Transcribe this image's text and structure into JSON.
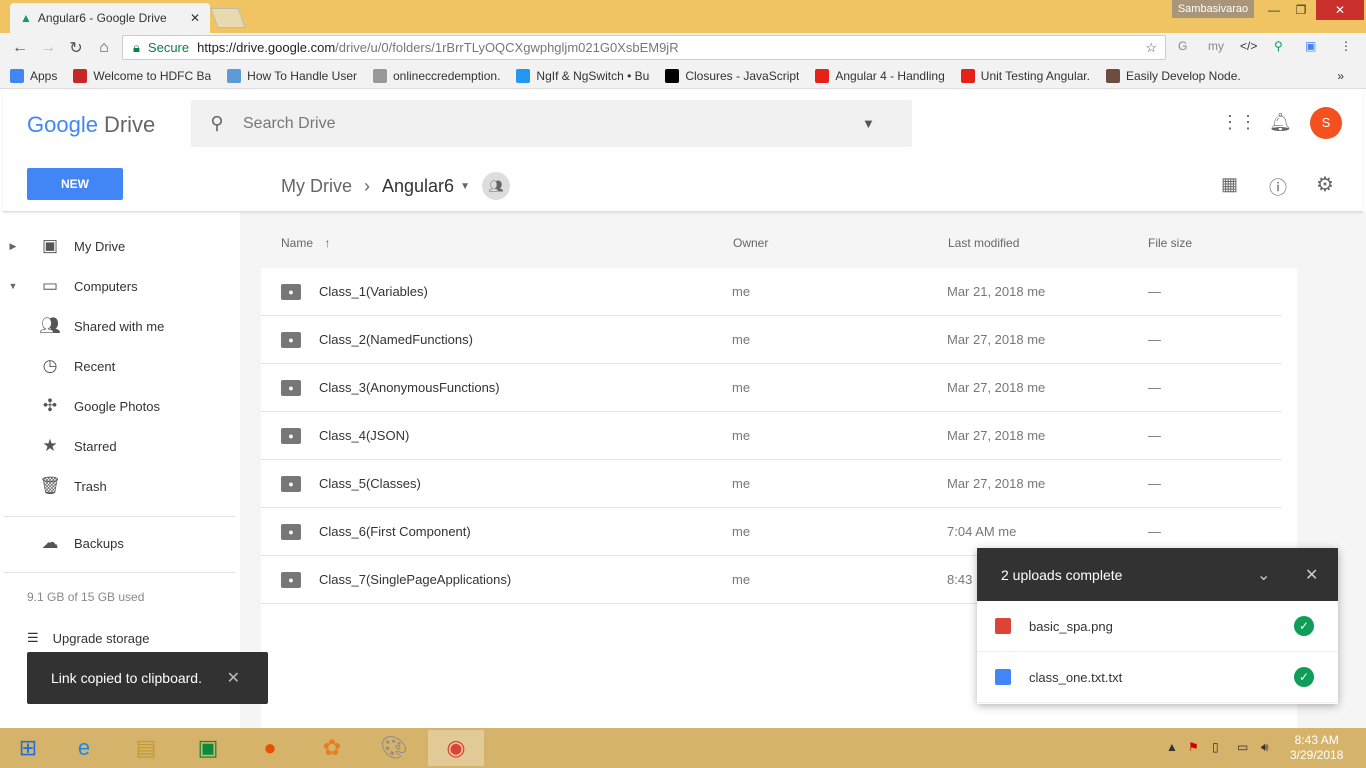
{
  "browser": {
    "tab_title": "Angular6 - Google Drive",
    "user": "Sambasivarao",
    "secure_label": "Secure",
    "url_host": "https://drive.google.com",
    "url_path": "/drive/u/0/folders/1rBrrTLyOQCXgwphgljm021G0XsbEM9jR",
    "bookmarks": [
      {
        "label": "Apps",
        "color": "#4285f4"
      },
      {
        "label": "Welcome to HDFC Ba",
        "color": "#c62828"
      },
      {
        "label": "How To Handle User",
        "color": "#5c9bd5"
      },
      {
        "label": "onlineccredemption.",
        "color": "#999"
      },
      {
        "label": "NgIf & NgSwitch • Bu",
        "color": "#2196f3"
      },
      {
        "label": "Closures - JavaScript",
        "color": "#000"
      },
      {
        "label": "Angular 4 - Handling",
        "color": "#e62117"
      },
      {
        "label": "Unit Testing Angular.",
        "color": "#e62117"
      },
      {
        "label": "Easily Develop Node.",
        "color": "#6d4c41"
      }
    ]
  },
  "drive": {
    "logo_google": "Google",
    "logo_drive": "Drive",
    "search_placeholder": "Search Drive",
    "avatar": "S",
    "new_label": "NEW",
    "breadcrumb": {
      "root": "My Drive",
      "current": "Angular6"
    },
    "sidebar": [
      {
        "label": "My Drive",
        "icon": "drive-icon",
        "arrow": "▶"
      },
      {
        "label": "Computers",
        "icon": "computer-icon",
        "arrow": "▼"
      },
      {
        "label": "Shared with me",
        "icon": "people-icon",
        "arrow": ""
      },
      {
        "label": "Recent",
        "icon": "clock-icon",
        "arrow": ""
      },
      {
        "label": "Google Photos",
        "icon": "photos-icon",
        "arrow": ""
      },
      {
        "label": "Starred",
        "icon": "star-icon",
        "arrow": ""
      },
      {
        "label": "Trash",
        "icon": "trash-icon",
        "arrow": ""
      }
    ],
    "backups": "Backups",
    "quota": "9.1 GB of 15 GB used",
    "upgrade": "Upgrade storage",
    "columns": {
      "name": "Name",
      "owner": "Owner",
      "modified": "Last modified",
      "size": "File size"
    },
    "files": [
      {
        "name": "Class_1(Variables)",
        "owner": "me",
        "modified": "Mar 21, 2018 me",
        "size": "—"
      },
      {
        "name": "Class_2(NamedFunctions)",
        "owner": "me",
        "modified": "Mar 27, 2018 me",
        "size": "—"
      },
      {
        "name": "Class_3(AnonymousFunctions)",
        "owner": "me",
        "modified": "Mar 27, 2018 me",
        "size": "—"
      },
      {
        "name": "Class_4(JSON)",
        "owner": "me",
        "modified": "Mar 27, 2018 me",
        "size": "—"
      },
      {
        "name": "Class_5(Classes)",
        "owner": "me",
        "modified": "Mar 27, 2018 me",
        "size": "—"
      },
      {
        "name": "Class_6(First Component)",
        "owner": "me",
        "modified": "7:04 AM me",
        "size": "—"
      },
      {
        "name": "Class_7(SinglePageApplications)",
        "owner": "me",
        "modified": "8:43",
        "size": ""
      }
    ],
    "toast": "Link copied to clipboard.",
    "uploads": {
      "title": "2 uploads complete",
      "items": [
        {
          "name": "basic_spa.png",
          "color": "#db4437",
          "icon": "image-icon"
        },
        {
          "name": "class_one.txt.txt",
          "color": "#4285f4",
          "icon": "doc-icon"
        }
      ]
    }
  },
  "taskbar": {
    "time": "8:43 AM",
    "date": "3/29/2018"
  }
}
